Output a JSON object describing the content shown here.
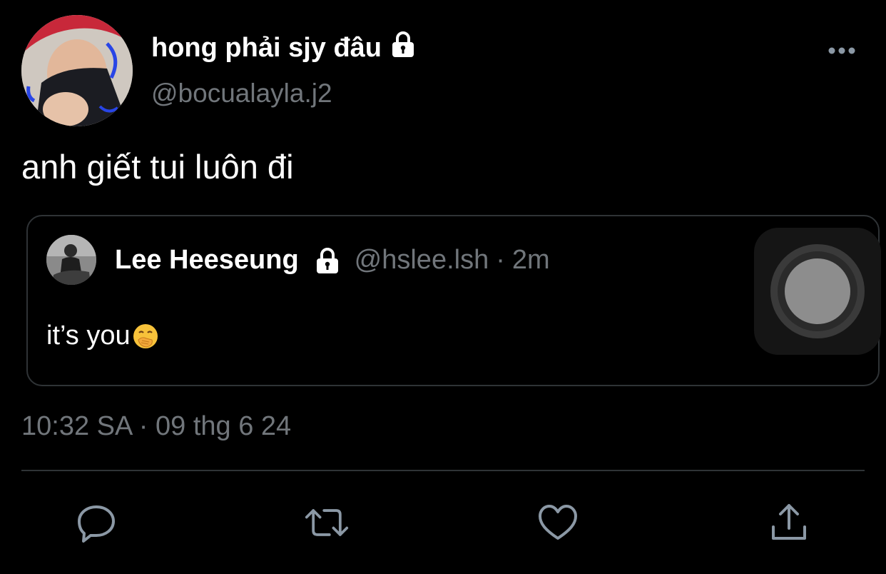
{
  "tweet": {
    "author": {
      "display_name": "hong phải sjy đâu",
      "handle": "@bocualayla.j2",
      "protected": true
    },
    "text": "anh giết tui luôn đi",
    "timestamp": "10:32 SA · 09 thg 6 24"
  },
  "quote": {
    "display_name": "Lee Heeseung",
    "handle": "@hslee.lsh",
    "separator": "·",
    "time": "2m",
    "protected": true,
    "text": "it’s you",
    "emoji": "face-with-hand-over-mouth"
  },
  "actions": [
    "reply-icon",
    "retweet-icon",
    "like-icon",
    "share-icon"
  ],
  "colors": {
    "background": "#000000",
    "primary_text": "#ffffff",
    "secondary_text": "#71767b",
    "border": "#2f3336"
  }
}
